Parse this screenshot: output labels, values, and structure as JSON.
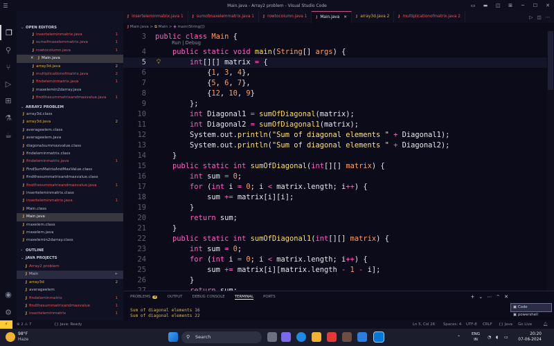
{
  "window": {
    "title": "Main.java - Array2 problem - Visual Studio Code",
    "menu_icon": "hamburger-icon"
  },
  "activity_icons": [
    "explorer-icon",
    "search-icon",
    "source-control-icon",
    "run-debug-icon",
    "extensions-icon",
    "test-icon",
    "java-projects-icon",
    "account-icon",
    "manage-gear-icon"
  ],
  "sidebar": {
    "open_editors_title": "OPEN EDITORS",
    "open_editors": [
      {
        "icon": "J",
        "name": "inserteleminmatrix.java",
        "badge": "1",
        "state": "err"
      },
      {
        "icon": "J",
        "name": "sumofmaxelemmatrix.java",
        "badge": "1",
        "state": "err"
      },
      {
        "icon": "J",
        "name": "rowtocolumn.java",
        "badge": "1",
        "state": "err"
      },
      {
        "icon": "J",
        "name": "Main.java",
        "badge": "",
        "state": "selected"
      },
      {
        "icon": "J",
        "name": "array3d.java",
        "badge": "2",
        "state": "warn"
      },
      {
        "icon": "J",
        "name": "multiplicationofmatrix.java",
        "badge": "2",
        "state": "err"
      },
      {
        "icon": "J",
        "name": "findeleminmatrix.java",
        "badge": "1",
        "state": "err"
      },
      {
        "icon": "J",
        "name": "maxelemin2darray.java",
        "badge": "",
        "state": "normal"
      },
      {
        "icon": "J",
        "name": "findthesummatrixandmaxvalue.java",
        "badge": "1",
        "state": "err"
      }
    ],
    "project_title": "ARRAY2 PROBLEM",
    "project_files": [
      {
        "icon": "J",
        "name": "array3d.class",
        "badge": "",
        "state": "normal"
      },
      {
        "icon": "J",
        "name": "array3d.java",
        "badge": "2",
        "state": "warn"
      },
      {
        "icon": "J",
        "name": "averageelem.class",
        "badge": "",
        "state": "normal"
      },
      {
        "icon": "J",
        "name": "averageelem.java",
        "badge": "",
        "state": "normal"
      },
      {
        "icon": "J",
        "name": "diagonalsummaxvalue.class",
        "badge": "",
        "state": "normal"
      },
      {
        "icon": "J",
        "name": "findeleminmatrix.class",
        "badge": "",
        "state": "normal"
      },
      {
        "icon": "J",
        "name": "findeleminmatrix.java",
        "badge": "1",
        "state": "err"
      },
      {
        "icon": "J",
        "name": "FindSumMatrixAndMaxValue.class",
        "badge": "",
        "state": "normal"
      },
      {
        "icon": "J",
        "name": "findthesummatrixandmaxvalue.class",
        "badge": "",
        "state": "normal"
      },
      {
        "icon": "J",
        "name": "findthesummatrixandmaxvalue.java",
        "badge": "1",
        "state": "err"
      },
      {
        "icon": "J",
        "name": "inserteleminmatrix.class",
        "badge": "",
        "state": "normal"
      },
      {
        "icon": "J",
        "name": "inserteleminmatrix.java",
        "badge": "1",
        "state": "err"
      },
      {
        "icon": "J",
        "name": "Main.class",
        "badge": "",
        "state": "normal"
      },
      {
        "icon": "J",
        "name": "Main.java",
        "badge": "",
        "state": "selected"
      },
      {
        "icon": "J",
        "name": "maxelem.class",
        "badge": "",
        "state": "normal"
      },
      {
        "icon": "J",
        "name": "maxelem.java",
        "badge": "",
        "state": "normal"
      },
      {
        "icon": "J",
        "name": "maxelemin2darray.class",
        "badge": "",
        "state": "normal"
      }
    ],
    "outline_title": "OUTLINE",
    "java_projects_title": "JAVA PROJECTS",
    "java_projects": [
      {
        "icon": "J",
        "name": "Array2 problem",
        "badge": "",
        "state": "err"
      },
      {
        "icon": "J",
        "name": "Main",
        "badge": "+",
        "state": "hover"
      },
      {
        "icon": "J",
        "name": "array3d",
        "badge": "2",
        "state": "warn"
      },
      {
        "icon": "J",
        "name": "averageelem",
        "badge": "",
        "state": "normal"
      },
      {
        "icon": "J",
        "name": "findeleminmatrix",
        "badge": "1",
        "state": "err"
      },
      {
        "icon": "J",
        "name": "findthesummatrixandmaxvalue",
        "badge": "1",
        "state": "err"
      },
      {
        "icon": "J",
        "name": "inserteleminmatrix",
        "badge": "1",
        "state": "err"
      }
    ]
  },
  "tabs": [
    {
      "icon": "J",
      "label": "inserteleminmatrix.java 1",
      "state": "err"
    },
    {
      "icon": "J",
      "label": "sumofmaxelemmatrix.java 1",
      "state": "err"
    },
    {
      "icon": "J",
      "label": "rowtocolumn.java 1",
      "state": "err"
    },
    {
      "icon": "J",
      "label": "Main.java",
      "state": "active"
    },
    {
      "icon": "J",
      "label": "array3d.java 2",
      "state": "warn"
    },
    {
      "icon": "J",
      "label": "multiplicationofmatrix.java 2",
      "state": "err"
    }
  ],
  "tab_actions": [
    "run-icon",
    "split-editor-icon",
    "more-icon"
  ],
  "breadcrumb": {
    "file": "Main.java",
    "sep1": ">",
    "class": "Main",
    "sep2": ">",
    "method": "main(String[])"
  },
  "editor": {
    "codelens": "Run | Debug",
    "lines": [
      {
        "n": "3",
        "tokens": [
          [
            "k",
            "public "
          ],
          [
            "k",
            "class "
          ],
          [
            "t",
            "Main "
          ],
          [
            "v",
            "{"
          ]
        ]
      },
      {
        "n": "4",
        "tokens": [
          [
            "v",
            "    "
          ],
          [
            "k",
            "public "
          ],
          [
            "k",
            "static "
          ],
          [
            "k",
            "void "
          ],
          [
            "f",
            "main"
          ],
          [
            "v",
            "("
          ],
          [
            "t",
            "String"
          ],
          [
            "v",
            "[] "
          ],
          [
            "t",
            "args"
          ],
          [
            "v",
            ") {"
          ]
        ]
      },
      {
        "n": "5",
        "tokens": [
          [
            "v",
            "        "
          ],
          [
            "k",
            "int"
          ],
          [
            "v",
            "[][] matrix "
          ],
          [
            "o",
            "="
          ],
          [
            "v",
            " {"
          ]
        ],
        "current": true
      },
      {
        "n": "6",
        "tokens": [
          [
            "v",
            "            {"
          ],
          [
            "n",
            "1"
          ],
          [
            "v",
            ", "
          ],
          [
            "n",
            "3"
          ],
          [
            "v",
            ", "
          ],
          [
            "n",
            "4"
          ],
          [
            "v",
            "},"
          ]
        ]
      },
      {
        "n": "7",
        "tokens": [
          [
            "v",
            "            {"
          ],
          [
            "n",
            "5"
          ],
          [
            "v",
            ", "
          ],
          [
            "n",
            "6"
          ],
          [
            "v",
            ", "
          ],
          [
            "n",
            "7"
          ],
          [
            "v",
            "},"
          ]
        ]
      },
      {
        "n": "8",
        "tokens": [
          [
            "v",
            "            {"
          ],
          [
            "n",
            "12"
          ],
          [
            "v",
            ", "
          ],
          [
            "n",
            "10"
          ],
          [
            "v",
            ", "
          ],
          [
            "n",
            "9"
          ],
          [
            "v",
            "}"
          ]
        ]
      },
      {
        "n": "9",
        "tokens": [
          [
            "v",
            "        };"
          ]
        ]
      },
      {
        "n": "10",
        "tokens": [
          [
            "v",
            "        "
          ],
          [
            "k",
            "int "
          ],
          [
            "v",
            "Diagonal1 "
          ],
          [
            "o",
            "= "
          ],
          [
            "f",
            "sumOfDiagonal"
          ],
          [
            "v",
            "(matrix);"
          ]
        ]
      },
      {
        "n": "11",
        "tokens": [
          [
            "v",
            "        "
          ],
          [
            "k",
            "int "
          ],
          [
            "v",
            "Diagonal2 "
          ],
          [
            "o",
            "= "
          ],
          [
            "f",
            "sumOfDiagonal1"
          ],
          [
            "v",
            "(matrix);"
          ]
        ]
      },
      {
        "n": "12",
        "tokens": [
          [
            "v",
            "        System.out."
          ],
          [
            "f",
            "println"
          ],
          [
            "v",
            "("
          ],
          [
            "s",
            "\"Sum of diagonal elements \""
          ],
          [
            "o",
            " + "
          ],
          [
            "v",
            "Diagonal1);"
          ]
        ]
      },
      {
        "n": "13",
        "tokens": [
          [
            "v",
            "        System.out."
          ],
          [
            "f",
            "println"
          ],
          [
            "v",
            "("
          ],
          [
            "s",
            "\"Sum of diagonal elements \""
          ],
          [
            "o",
            " + "
          ],
          [
            "v",
            "Diagonal2);"
          ]
        ]
      },
      {
        "n": "14",
        "tokens": [
          [
            "v",
            "    }"
          ]
        ]
      },
      {
        "n": "15",
        "tokens": [
          [
            "v",
            "    "
          ],
          [
            "k",
            "public "
          ],
          [
            "k",
            "static "
          ],
          [
            "k",
            "int "
          ],
          [
            "f",
            "sumOfDiagonal"
          ],
          [
            "v",
            "("
          ],
          [
            "k",
            "int"
          ],
          [
            "v",
            "[][] "
          ],
          [
            "t",
            "matrix"
          ],
          [
            "v",
            ") {"
          ]
        ]
      },
      {
        "n": "16",
        "tokens": [
          [
            "v",
            "        "
          ],
          [
            "k",
            "int "
          ],
          [
            "v",
            "sum "
          ],
          [
            "o",
            "= "
          ],
          [
            "n",
            "0"
          ],
          [
            "v",
            ";"
          ]
        ]
      },
      {
        "n": "17",
        "tokens": [
          [
            "v",
            "        "
          ],
          [
            "k",
            "for "
          ],
          [
            "v",
            "("
          ],
          [
            "k",
            "int "
          ],
          [
            "v",
            "i "
          ],
          [
            "o",
            "= "
          ],
          [
            "n",
            "0"
          ],
          [
            "v",
            "; i "
          ],
          [
            "o",
            "< "
          ],
          [
            "v",
            "matrix.length; i"
          ],
          [
            "o",
            "++"
          ],
          [
            "v",
            ") {"
          ]
        ]
      },
      {
        "n": "18",
        "tokens": [
          [
            "v",
            "            sum "
          ],
          [
            "o",
            "+= "
          ],
          [
            "v",
            "matrix[i][i];"
          ]
        ]
      },
      {
        "n": "19",
        "tokens": [
          [
            "v",
            "        }"
          ]
        ]
      },
      {
        "n": "20",
        "tokens": [
          [
            "v",
            "        "
          ],
          [
            "k",
            "return "
          ],
          [
            "v",
            "sum;"
          ]
        ]
      },
      {
        "n": "21",
        "tokens": [
          [
            "v",
            "    }"
          ]
        ]
      },
      {
        "n": "22",
        "tokens": [
          [
            "v",
            "    "
          ],
          [
            "k",
            "public "
          ],
          [
            "k",
            "static "
          ],
          [
            "k",
            "int "
          ],
          [
            "f",
            "sumOfDiagonal1"
          ],
          [
            "v",
            "("
          ],
          [
            "k",
            "int"
          ],
          [
            "v",
            "[][] "
          ],
          [
            "t",
            "matrix"
          ],
          [
            "v",
            ") {"
          ]
        ]
      },
      {
        "n": "23",
        "tokens": [
          [
            "v",
            "        "
          ],
          [
            "k",
            "int "
          ],
          [
            "v",
            "sum "
          ],
          [
            "o",
            "= "
          ],
          [
            "n",
            "0"
          ],
          [
            "v",
            ";"
          ]
        ]
      },
      {
        "n": "24",
        "tokens": [
          [
            "v",
            "        "
          ],
          [
            "k",
            "for "
          ],
          [
            "v",
            "("
          ],
          [
            "k",
            "int "
          ],
          [
            "v",
            "i "
          ],
          [
            "o",
            "= "
          ],
          [
            "n",
            "0"
          ],
          [
            "v",
            "; i "
          ],
          [
            "o",
            "< "
          ],
          [
            "v",
            "matrix.length; i"
          ],
          [
            "o",
            "++"
          ],
          [
            "v",
            ") {"
          ]
        ]
      },
      {
        "n": "25",
        "tokens": [
          [
            "v",
            "            sum "
          ],
          [
            "o",
            "+= "
          ],
          [
            "v",
            "matrix[i][matrix.length "
          ],
          [
            "o",
            "- "
          ],
          [
            "n",
            "1 "
          ],
          [
            "o",
            "- "
          ],
          [
            "v",
            "i];"
          ]
        ]
      },
      {
        "n": "26",
        "tokens": [
          [
            "v",
            "        }"
          ]
        ]
      },
      {
        "n": "27",
        "tokens": [
          [
            "v",
            "        "
          ],
          [
            "k",
            "return "
          ],
          [
            "v",
            "sum;"
          ]
        ]
      }
    ]
  },
  "panel": {
    "tabs": [
      "PROBLEMS",
      "OUTPUT",
      "DEBUG CONSOLE",
      "TERMINAL",
      "PORTS"
    ],
    "problems_count": "9",
    "active_tab": "TERMINAL",
    "output_lines": [
      "Sum of diagonal elements 16",
      "Sum of diagonal elements 22"
    ],
    "terminals": [
      "Code",
      "powershell"
    ]
  },
  "statusbar": {
    "problems": "⊗ 2  ⚠ 7",
    "java": "{} Java: Ready",
    "position": "Ln 5, Col 26",
    "spaces": "Spaces: 4",
    "encoding": "UTF-8",
    "eol": "CRLF",
    "language": "{} Java",
    "golive": "Go Live"
  },
  "taskbar": {
    "temp": "98°F",
    "weather_text": "Haze",
    "search_placeholder": "Search",
    "lang_top": "ENG",
    "lang_bottom": "IN",
    "time": "20:20",
    "date": "07-06-2024"
  },
  "colors": {
    "keyword": "#ff5ec1",
    "function": "#ffde59",
    "string": "#ffe27a",
    "number": "#ff9e64",
    "error": "#e15a5a",
    "warning": "#d9b44a"
  }
}
